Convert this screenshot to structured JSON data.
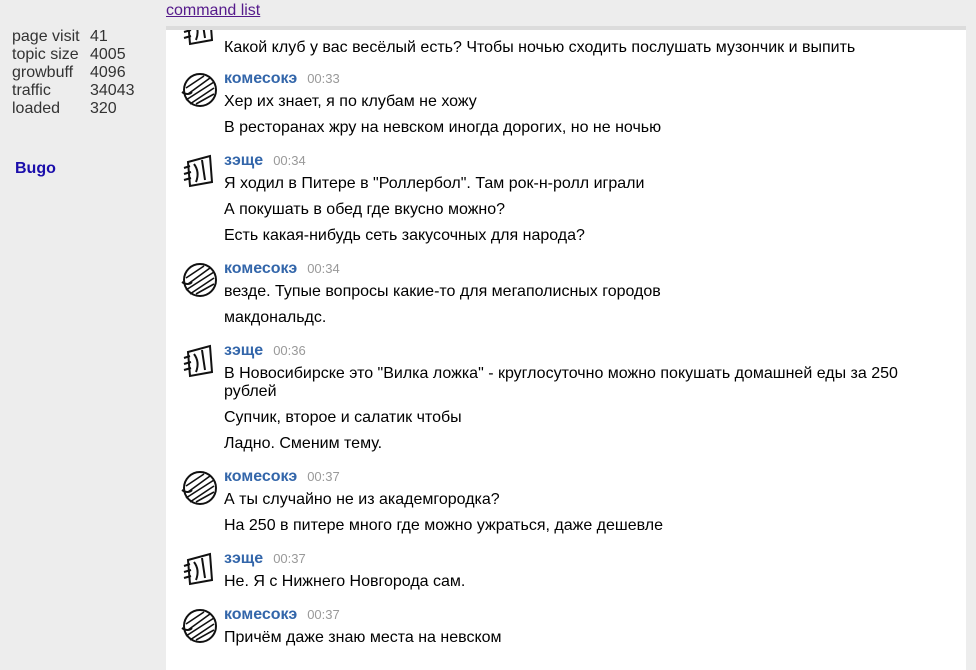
{
  "header": {
    "command_link": "command list"
  },
  "stats": [
    {
      "label": "page visit",
      "value": "41"
    },
    {
      "label": "topic size",
      "value": "4005"
    },
    {
      "label": "growbuff",
      "value": "4096"
    },
    {
      "label": "traffic",
      "value": "34043"
    },
    {
      "label": "loaded",
      "value": "320"
    }
  ],
  "sidebar": {
    "brand": "Bugo"
  },
  "chat": {
    "messages": [
      {
        "author": "",
        "time": "",
        "avatar": "zeshche",
        "lines": [
          "Какой клуб у вас весёлый есть? Чтобы ночью сходить послушать музончик и выпить"
        ]
      },
      {
        "author": "комесокэ",
        "time": "00:33",
        "avatar": "komesoke",
        "lines": [
          "Хер их знает, я по клубам не хожу",
          "В ресторанах жру на невском иногда дорогих, но не ночью"
        ]
      },
      {
        "author": "зэще",
        "time": "00:34",
        "avatar": "zeshche",
        "lines": [
          "Я ходил в Питере в \"Роллербол\". Там рок-н-ролл играли",
          "А покушать в обед где вкусно можно?",
          "Есть какая-нибудь сеть закусочных для народа?"
        ]
      },
      {
        "author": "комесокэ",
        "time": "00:34",
        "avatar": "komesoke",
        "lines": [
          "везде. Тупые вопросы какие-то для мегаполисных городов",
          "макдональдс."
        ]
      },
      {
        "author": "зэще",
        "time": "00:36",
        "avatar": "zeshche",
        "lines": [
          "В Новосибирске это \"Вилка ложка\" - круглосуточно можно покушать домашней еды за 250 рублей",
          "Супчик, второе и салатик чтобы",
          "Ладно. Сменим тему."
        ]
      },
      {
        "author": "комесокэ",
        "time": "00:37",
        "avatar": "komesoke",
        "lines": [
          "А ты случайно не из академгородка?",
          "На 250 в питере много где можно ужраться, даже дешевле"
        ]
      },
      {
        "author": "зэще",
        "time": "00:37",
        "avatar": "zeshche",
        "lines": [
          "Не. Я с Нижнего Новгорода сам."
        ]
      },
      {
        "author": "комесокэ",
        "time": "00:37",
        "avatar": "komesoke",
        "lines": [
          "Причём даже знаю места на невском"
        ]
      }
    ]
  }
}
